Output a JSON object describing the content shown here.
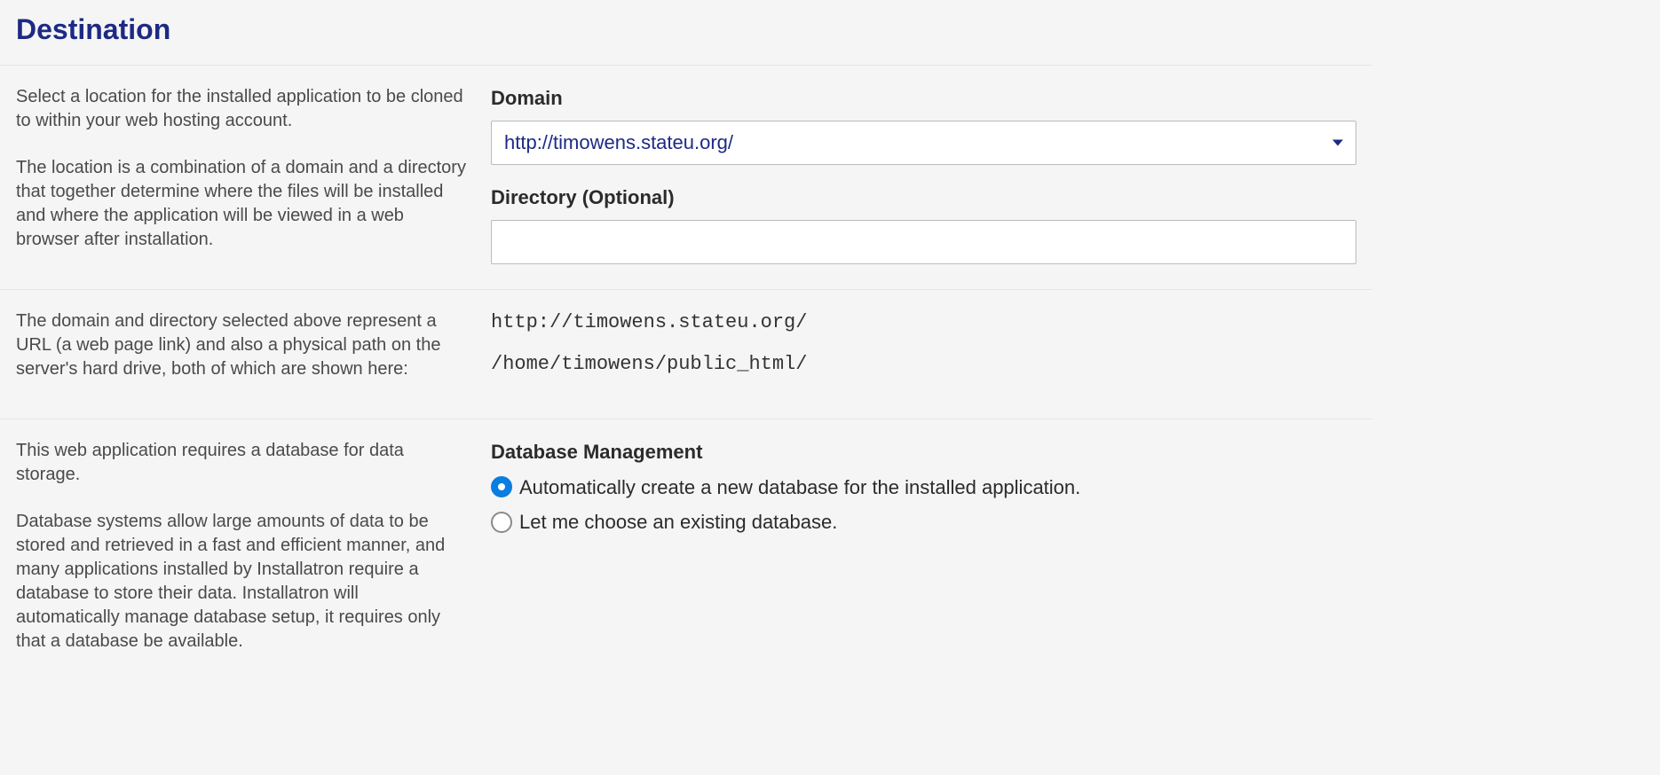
{
  "header": {
    "title": "Destination"
  },
  "location": {
    "desc_p1": "Select a location for the installed application to be cloned to within your web hosting account.",
    "desc_p2": "The location is a combination of a domain and a directory that together determine where the files will be installed and where the application will be viewed in a web browser after installation.",
    "domain_label": "Domain",
    "domain_value": "http://timowens.stateu.org/",
    "directory_label": "Directory (Optional)",
    "directory_value": ""
  },
  "paths": {
    "desc": "The domain and directory selected above represent a URL (a web page link) and also a physical path on the server's hard drive, both of which are shown here:",
    "url": "http://timowens.stateu.org/",
    "filesystem": "/home/timowens/public_html/"
  },
  "database": {
    "desc_p1": "This web application requires a database for data storage.",
    "desc_p2": "Database systems allow large amounts of data to be stored and retrieved in a fast and efficient manner, and many applications installed by Installatron require a database to store their data. Installatron will automatically manage database setup, it requires only that a database be available.",
    "heading": "Database Management",
    "option_auto": "Automatically create a new database for the installed application.",
    "option_existing": "Let me choose an existing database."
  }
}
